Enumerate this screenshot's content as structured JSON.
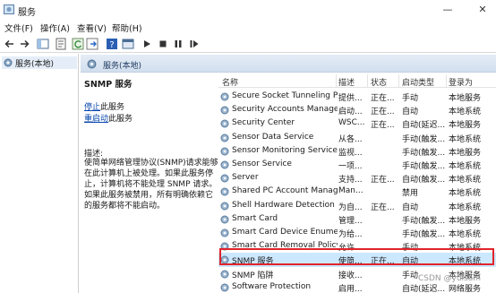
{
  "window": {
    "title": "服务",
    "minimize": "—",
    "close": "✕"
  },
  "menu": [
    "文件(F)",
    "操作(A)",
    "查看(V)",
    "帮助(H)"
  ],
  "tree": {
    "root_label": "服务(本地)"
  },
  "header": {
    "label": "服务(本地)"
  },
  "detail": {
    "service_title": "SNMP 服务",
    "stop_link": "停止",
    "stop_suffix": "此服务",
    "restart_link": "重启动",
    "restart_suffix": "此服务",
    "description_label": "描述:",
    "description_text": "使简单网络管理协议(SNMP)请求能够在此计算机上被处理。如果此服务停止，计算机将不能处理 SNMP 请求。如果此服务被禁用，所有明确依赖它的服务都将不能启动。"
  },
  "columns": {
    "name": "名称",
    "description": "描述",
    "status": "状态",
    "startup": "启动类型",
    "logon": "登录为"
  },
  "rows": [
    {
      "name": "Secure Socket Tunneling P...",
      "description": "提供...",
      "status": "正在...",
      "startup": "手动",
      "logon": "本地服务"
    },
    {
      "name": "Security Accounts Manager",
      "description": "启动...",
      "status": "正在...",
      "startup": "自动",
      "logon": "本地系统"
    },
    {
      "name": "Security Center",
      "description": "WSC...",
      "status": "正在...",
      "startup": "自动(延迟...",
      "logon": "本地服务"
    },
    {
      "name": "Sensor Data Service",
      "description": "从各...",
      "status": "",
      "startup": "手动(触发...",
      "logon": "本地系统"
    },
    {
      "name": "Sensor Monitoring Service",
      "description": "监视...",
      "status": "",
      "startup": "手动(触发...",
      "logon": "本地服务"
    },
    {
      "name": "Sensor Service",
      "description": "一项...",
      "status": "",
      "startup": "手动(触发...",
      "logon": "本地系统"
    },
    {
      "name": "Server",
      "description": "支持...",
      "status": "正在...",
      "startup": "自动(触发...",
      "logon": "本地系统"
    },
    {
      "name": "Shared PC Account Manager",
      "description": "Man...",
      "status": "",
      "startup": "禁用",
      "logon": "本地系统"
    },
    {
      "name": "Shell Hardware Detection",
      "description": "为自...",
      "status": "正在...",
      "startup": "自动",
      "logon": "本地系统"
    },
    {
      "name": "Smart Card",
      "description": "管理...",
      "status": "",
      "startup": "手动(触发...",
      "logon": "本地服务"
    },
    {
      "name": "Smart Card Device Enumer...",
      "description": "为给...",
      "status": "",
      "startup": "手动(触发...",
      "logon": "本地系统"
    },
    {
      "name": "Smart Card Removal Policy",
      "description": "允许...",
      "status": "",
      "startup": "手动",
      "logon": "本地系统"
    },
    {
      "name": "SNMP 服务",
      "description": "使简...",
      "status": "正在...",
      "startup": "自动",
      "logon": "本地系统"
    },
    {
      "name": "SNMP 陷阱",
      "description": "接收...",
      "status": "",
      "startup": "手动",
      "logon": "本地服务"
    },
    {
      "name": "Software Protection",
      "description": "启用...",
      "status": "",
      "startup": "自动(延迟...",
      "logon": "网络服务"
    }
  ],
  "selected_row": 12,
  "watermark": "CSDN @yuisam",
  "colors": {
    "selection": "#cce8ff",
    "highlight_box": "#e1242b",
    "link": "#0645ad"
  },
  "icons": [
    "app-services-icon",
    "back-arrow-icon",
    "forward-arrow-icon",
    "console-tree-icon",
    "properties-icon",
    "refresh-icon",
    "export-icon",
    "help-icon",
    "console-icon",
    "play-icon",
    "stop-icon",
    "pause-icon",
    "restart-icon",
    "gear-icon"
  ]
}
